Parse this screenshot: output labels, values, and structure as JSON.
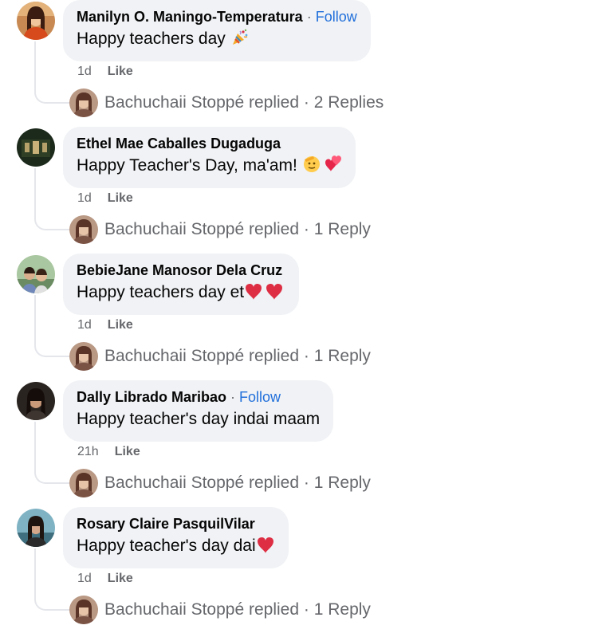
{
  "comments": [
    {
      "author": "Manilyn O. Maningo-Temperatura",
      "follow_sep": " · ",
      "follow": "Follow",
      "text": "Happy teachers day ",
      "emoji": "party-popper-icon",
      "time": "1d",
      "like": "Like",
      "replier": "Bachuchaii Stoppé",
      "replied_word": "replied",
      "reply_sep": "·",
      "reply_count": "2 Replies"
    },
    {
      "author": "Ethel Mae Caballes Dugaduga",
      "text": "Happy Teacher's Day, ma'am! ",
      "emoji": "saluting-face-and-hearts-icon",
      "time": "1d",
      "like": "Like",
      "replier": "Bachuchaii Stoppé",
      "replied_word": "replied",
      "reply_sep": "·",
      "reply_count": "1 Reply"
    },
    {
      "author": "BebieJane Manosor Dela Cruz",
      "text": "Happy teachers day et",
      "emoji": "two-red-hearts-icon",
      "time": "1d",
      "like": "Like",
      "replier": "Bachuchaii Stoppé",
      "replied_word": "replied",
      "reply_sep": "·",
      "reply_count": "1 Reply"
    },
    {
      "author": "Dally Librado Maribao",
      "follow_sep": " · ",
      "follow": "Follow",
      "text": "Happy teacher's day indai maam",
      "time": "21h",
      "like": "Like",
      "replier": "Bachuchaii Stoppé",
      "replied_word": "replied",
      "reply_sep": "·",
      "reply_count": "1 Reply"
    },
    {
      "author": "Rosary Claire PasquilVilar",
      "text": "Happy teacher's day dai",
      "emoji": "red-heart-icon",
      "time": "1d",
      "like": "Like",
      "replier": "Bachuchaii Stoppé",
      "replied_word": "replied",
      "reply_sep": "·",
      "reply_count": "1 Reply"
    }
  ],
  "colors": {
    "bubble_bg": "#f0f2f5",
    "secondary_text": "#65676b",
    "link_blue": "#216fdb",
    "thread_line": "#e4e6eb"
  }
}
